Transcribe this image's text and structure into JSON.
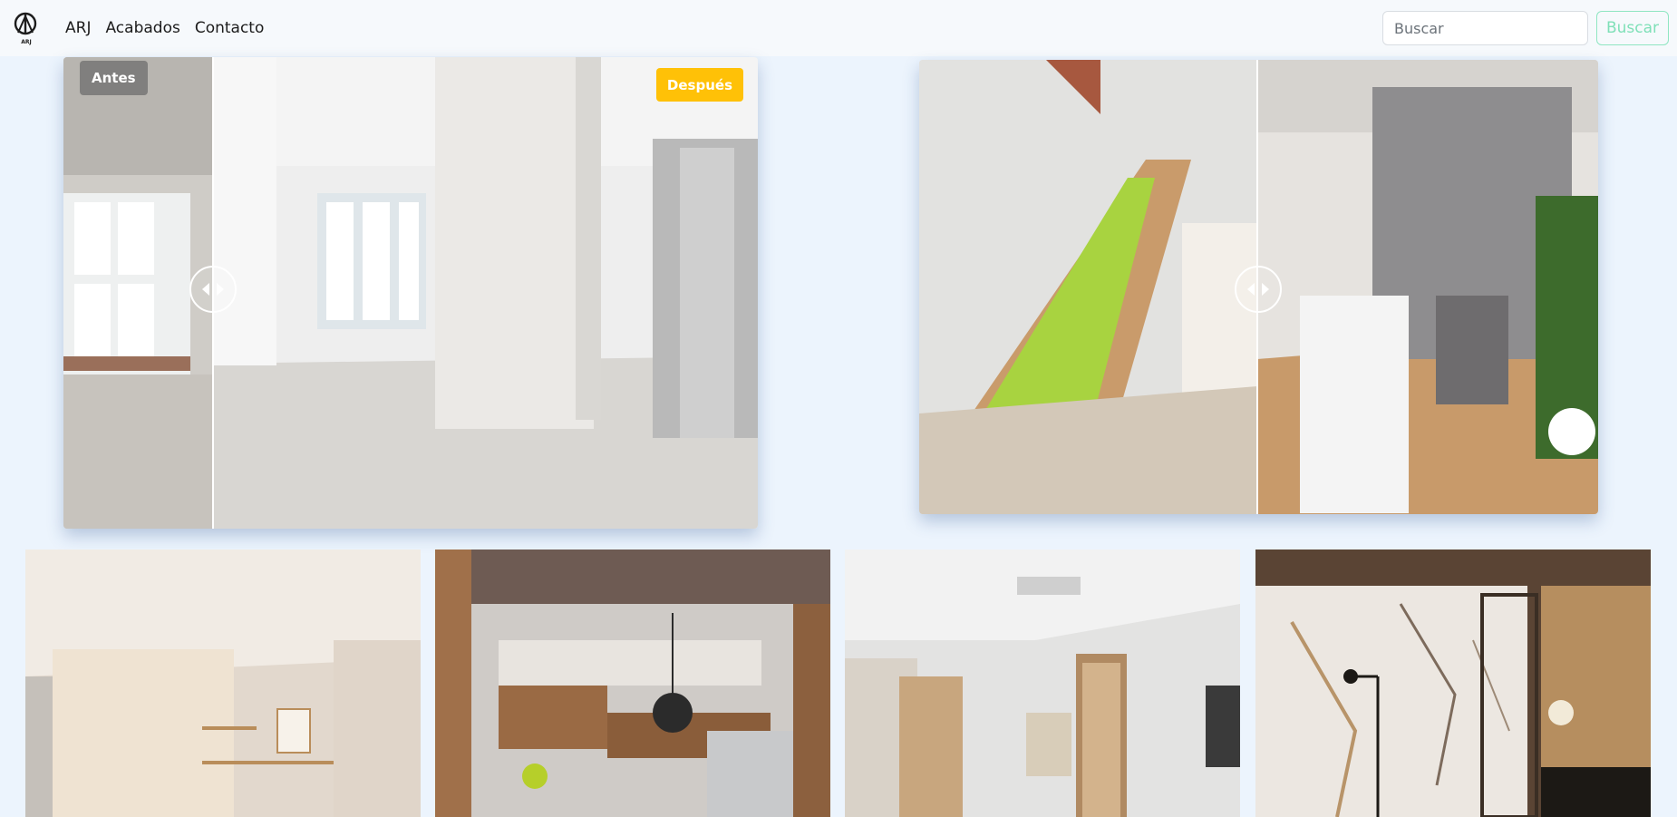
{
  "nav": {
    "brand_logo_text": "ARJ",
    "links": [
      "ARJ",
      "Acabados",
      "Contacto"
    ]
  },
  "search": {
    "placeholder": "Buscar",
    "button_label": "Buscar"
  },
  "sliders": [
    {
      "before_label": "Antes",
      "after_label": "Después",
      "position_pct": 21.5
    },
    {
      "before_label": "",
      "after_label": "",
      "position_pct": 50
    }
  ],
  "gallery": [
    {
      "icon": "living-room-photo"
    },
    {
      "icon": "kitchen-photo"
    },
    {
      "icon": "entryway-photo"
    },
    {
      "icon": "bathroom-photo"
    }
  ],
  "colors": {
    "accent_badge": "#ffc107",
    "search_button": "#7fe0b8",
    "page_background": "#ecf4fd"
  }
}
